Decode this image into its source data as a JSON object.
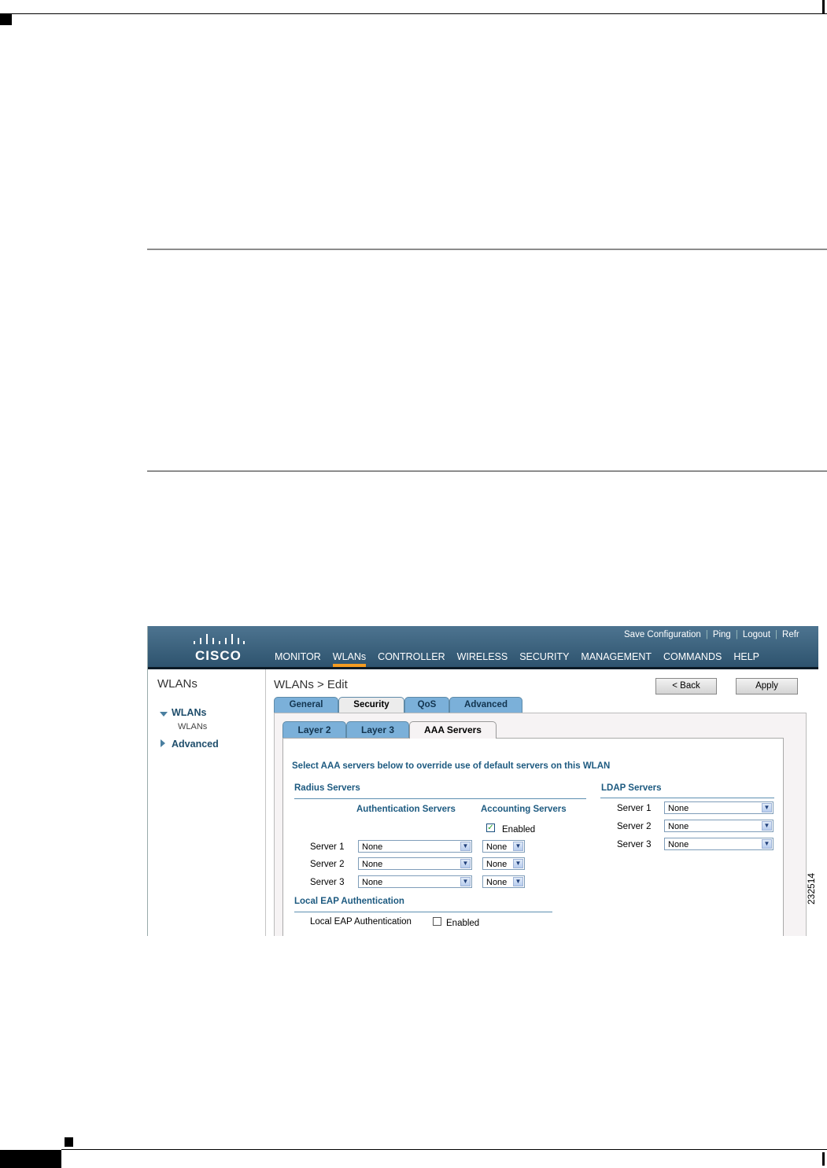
{
  "figure_id": "232514",
  "header": {
    "logo_text": "CISCO",
    "toplinks": [
      "Save Configuration",
      "Ping",
      "Logout",
      "Refr"
    ],
    "nav": [
      "MONITOR",
      "WLANs",
      "CONTROLLER",
      "WIRELESS",
      "SECURITY",
      "MANAGEMENT",
      "COMMANDS",
      "HELP"
    ],
    "active_nav": "WLANs"
  },
  "sidebar": {
    "title": "WLANs",
    "items": [
      {
        "label": "WLANs",
        "sub": "WLANs",
        "icon": "triangle-down-icon"
      },
      {
        "label": "Advanced",
        "icon": "triangle-right-icon"
      }
    ]
  },
  "main": {
    "title": "WLANs > Edit",
    "back_label": "< Back",
    "apply_label": "Apply",
    "tabs": [
      "General",
      "Security",
      "QoS",
      "Advanced"
    ],
    "active_tab": "Security",
    "subtabs": [
      "Layer 2",
      "Layer 3",
      "AAA Servers"
    ],
    "active_subtab": "AAA Servers",
    "instruction": "Select AAA servers below to override use of default servers on this WLAN",
    "radius": {
      "title": "Radius Servers",
      "auth_header": "Authentication Servers",
      "acct_header": "Accounting Servers",
      "acct_enabled_label": "Enabled",
      "acct_enabled": true,
      "rows": [
        {
          "label": "Server 1",
          "auth": "None",
          "acct": "None"
        },
        {
          "label": "Server 2",
          "auth": "None",
          "acct": "None"
        },
        {
          "label": "Server 3",
          "auth": "None",
          "acct": "None"
        }
      ]
    },
    "ldap": {
      "title": "LDAP Servers",
      "rows": [
        {
          "label": "Server 1",
          "value": "None"
        },
        {
          "label": "Server 2",
          "value": "None"
        },
        {
          "label": "Server 3",
          "value": "None"
        }
      ]
    },
    "local_eap": {
      "title": "Local EAP Authentication",
      "label": "Local EAP Authentication",
      "enabled_label": "Enabled",
      "enabled": false
    }
  }
}
